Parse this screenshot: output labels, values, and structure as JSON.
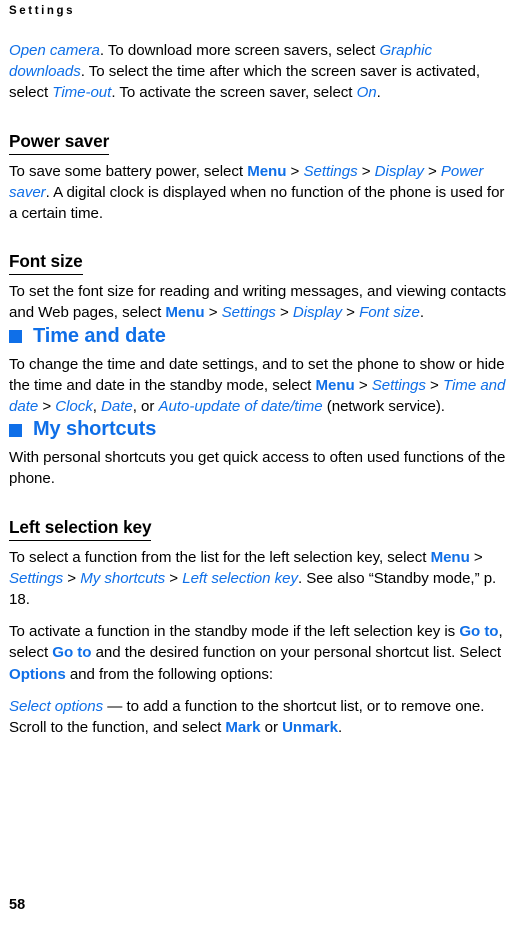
{
  "page": {
    "running_head": "Settings",
    "folio": "58",
    "accent_color": "#0f6fe8",
    "text_color": "#000000",
    "background_color": "#ffffff"
  },
  "blocks": {
    "screensaver_para": {
      "r1": "Open camera",
      "r2": ". To download more screen savers, select ",
      "r3": "Graphic downloads",
      "r4": ". To select the time after which the screen saver is activated, select ",
      "r5": "Time-out",
      "r6": ". To activate the screen saver, select ",
      "r7": "On",
      "r8": "."
    },
    "power_saver": {
      "heading": "Power saver",
      "r1": "To save some battery power, select ",
      "r2": "Menu",
      "r3": " > ",
      "r4": "Settings",
      "r5": " > ",
      "r6": "Display",
      "r7": " > ",
      "r8": "Power saver",
      "r9": ". A digital clock is displayed when no function of the phone is used for a certain time."
    },
    "font_size": {
      "heading": "Font size",
      "r1": "To set the font size for reading and writing messages, and viewing contacts and Web pages, select ",
      "r2": "Menu",
      "r3": " > ",
      "r4": "Settings",
      "r5": " > ",
      "r6": "Display",
      "r7": " > ",
      "r8": "Font size",
      "r9": "."
    },
    "time_and_date": {
      "heading": "Time and date",
      "bullet": "blue-square-icon",
      "r1": "To change the time and date settings, and to set the phone to show or hide the time and date in the standby mode, select ",
      "r2": "Menu",
      "r3": " > ",
      "r4": "Settings",
      "r5": " > ",
      "r6": "Time and date",
      "r7": " > ",
      "r8": "Clock",
      "r9": ", ",
      "r10": "Date",
      "r11": ", or ",
      "r12": "Auto-update of date/time",
      "r13": " (network service)."
    },
    "my_shortcuts": {
      "heading": "My shortcuts",
      "bullet": "blue-square-icon",
      "intro": "With personal shortcuts you get quick access to often used functions of the phone."
    },
    "left_selection_key": {
      "heading": "Left selection key",
      "p1": {
        "r1": "To select a function from the list for the left selection key, select ",
        "r2": "Menu",
        "r3": " > ",
        "r4": "Settings",
        "r5": " > ",
        "r6": "My shortcuts",
        "r7": " > ",
        "r8": "Left selection key",
        "r9": ". See also “Standby mode,” p. 18."
      },
      "p2": {
        "r1": "To activate a function in the standby mode if the left selection key is ",
        "r2": "Go to",
        "r3": ", select ",
        "r4": "Go to",
        "r5": " and the desired function on your personal shortcut list. Select ",
        "r6": "Options",
        "r7": " and from the following options:"
      },
      "p3": {
        "r1": "Select options",
        "r2": " — to add a function to the shortcut list, or to remove one. Scroll to the function, and select ",
        "r3": "Mark",
        "r4": " or ",
        "r5": "Unmark",
        "r6": "."
      }
    }
  }
}
